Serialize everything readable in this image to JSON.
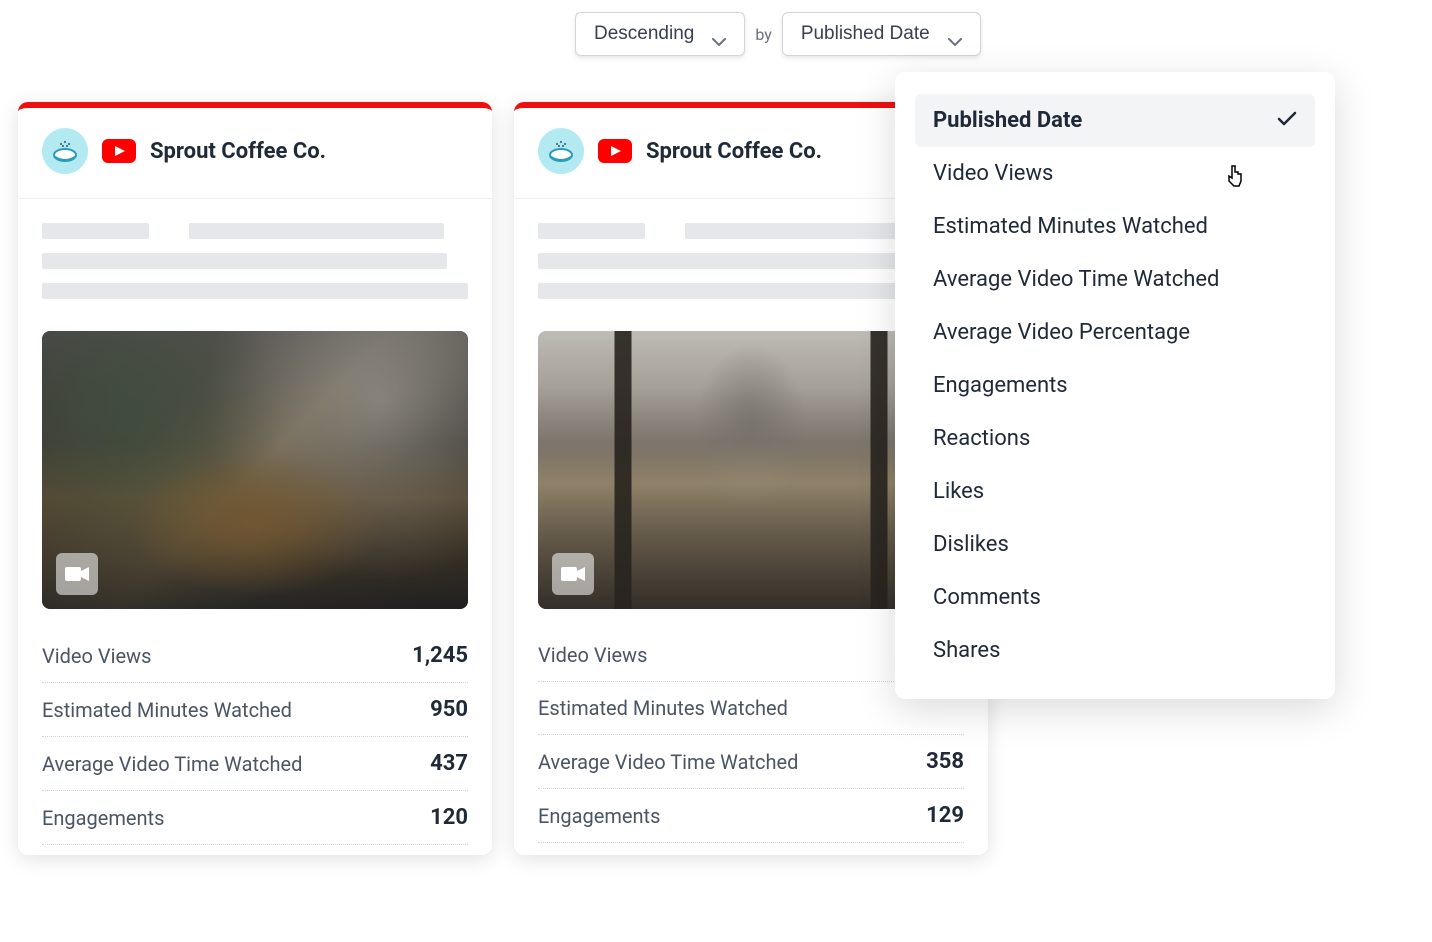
{
  "sort": {
    "direction_label": "Descending",
    "by_label": "by",
    "field_label": "Published Date"
  },
  "dropdown": {
    "selected_index": 0,
    "items": [
      {
        "label": "Published Date"
      },
      {
        "label": "Video Views"
      },
      {
        "label": "Estimated Minutes Watched"
      },
      {
        "label": "Average Video Time Watched"
      },
      {
        "label": "Average Video Percentage"
      },
      {
        "label": "Engagements"
      },
      {
        "label": "Reactions"
      },
      {
        "label": "Likes"
      },
      {
        "label": "Dislikes"
      },
      {
        "label": "Comments"
      },
      {
        "label": "Shares"
      }
    ]
  },
  "cards": [
    {
      "channel": "Sprout Coffee Co.",
      "metrics": [
        {
          "label": "Video Views",
          "value": "1,245"
        },
        {
          "label": "Estimated Minutes Watched",
          "value": "950"
        },
        {
          "label": "Average Video Time Watched",
          "value": "437"
        },
        {
          "label": "Engagements",
          "value": "120"
        }
      ]
    },
    {
      "channel": "Sprout Coffee Co.",
      "metrics": [
        {
          "label": "Video Views",
          "value": ""
        },
        {
          "label": "Estimated Minutes Watched",
          "value": ""
        },
        {
          "label": "Average Video Time Watched",
          "value": "358"
        },
        {
          "label": "Engagements",
          "value": "129"
        }
      ]
    }
  ]
}
